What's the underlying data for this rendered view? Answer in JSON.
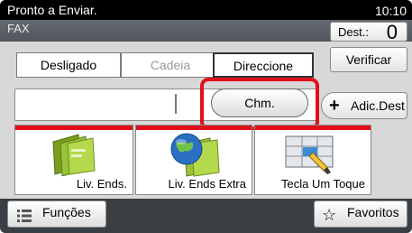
{
  "status": {
    "text": "Pronto a Enviar.",
    "time": "10:10"
  },
  "header": {
    "mode": "FAX",
    "dest_label": "Dest.:",
    "dest_count": "0"
  },
  "tabs": [
    {
      "label": "Desligado"
    },
    {
      "label": "Cadeia"
    },
    {
      "label": "Direccione"
    }
  ],
  "toolbar": {
    "verify": "Verificar",
    "chm": "Chm.",
    "add_dest": "Adic.Dest"
  },
  "destinations": [
    {
      "label": "Liv. Ends."
    },
    {
      "label": "Liv. Ends Extra"
    },
    {
      "label": "Tecla Um Toque"
    }
  ],
  "bottom": {
    "functions": "Funções",
    "favorites": "Favoritos"
  },
  "colors": {
    "highlight": "#e0101a",
    "accent_strip": "#e0101a",
    "status_bg": "#000000"
  }
}
